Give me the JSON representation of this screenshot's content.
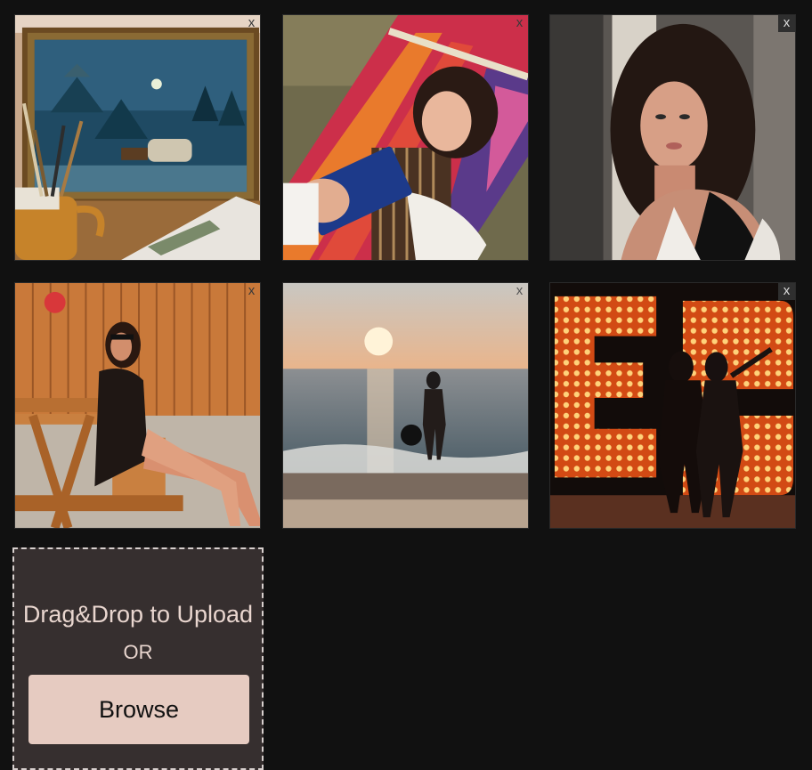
{
  "gallery": {
    "items": [
      {
        "subject": "framed winter cabin painting with paint brushes in a jug",
        "remove_label": "x"
      },
      {
        "subject": "woman reading blue book in striped hammock",
        "remove_label": "x"
      },
      {
        "subject": "woman with curly dark hair portrait",
        "remove_label": "x"
      },
      {
        "subject": "woman in sunglasses on picnic bench by wooden fence",
        "remove_label": "x"
      },
      {
        "subject": "woman walking into sea at sunset holding hat",
        "remove_label": "x"
      },
      {
        "subject": "two women silhouetted in front of lit marquee letters",
        "remove_label": "x"
      }
    ]
  },
  "upload": {
    "drag_drop_text": "Drag&Drop to Upload",
    "or_text": "OR",
    "browse_label": "Browse"
  },
  "colors": {
    "background": "#111111",
    "dropzone_bg": "#362f2f",
    "dropzone_text": "#e9d6cf",
    "browse_bg": "#e6cbc1"
  }
}
